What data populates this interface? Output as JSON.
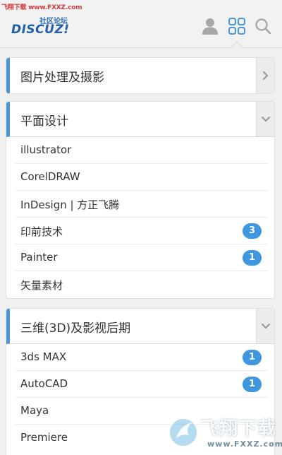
{
  "watermark": {
    "top_text": "飞翔下载 www.FXXZ.com",
    "bottom_text": "飞翔下载",
    "bottom_url": "www.FXXZ.com"
  },
  "logo": {
    "sub": "社区论坛",
    "main": "DISCUZ!"
  },
  "header": {
    "icons": [
      "user-icon",
      "grid-icon",
      "search-icon"
    ],
    "accent": "#4a96d6"
  },
  "sections": [
    {
      "title": "图片处理及摄影",
      "state": "collapsed",
      "items": []
    },
    {
      "title": "平面设计",
      "state": "expanded",
      "items": [
        {
          "label": "illustrator",
          "badge": ""
        },
        {
          "label": "CorelDRAW",
          "badge": ""
        },
        {
          "label": "InDesign | 方正飞腾",
          "badge": ""
        },
        {
          "label": "印前技术",
          "badge": "3"
        },
        {
          "label": "Painter",
          "badge": "1"
        },
        {
          "label": "矢量素材",
          "badge": ""
        }
      ]
    },
    {
      "title": "三维(3D)及影视后期",
      "state": "expanded",
      "items": [
        {
          "label": "3ds MAX",
          "badge": "1"
        },
        {
          "label": "AutoCAD",
          "badge": "1"
        },
        {
          "label": "Maya",
          "badge": ""
        },
        {
          "label": "Premiere",
          "badge": ""
        }
      ]
    }
  ],
  "colors": {
    "accent": "#4a96d6",
    "badge": "#3f97df"
  }
}
